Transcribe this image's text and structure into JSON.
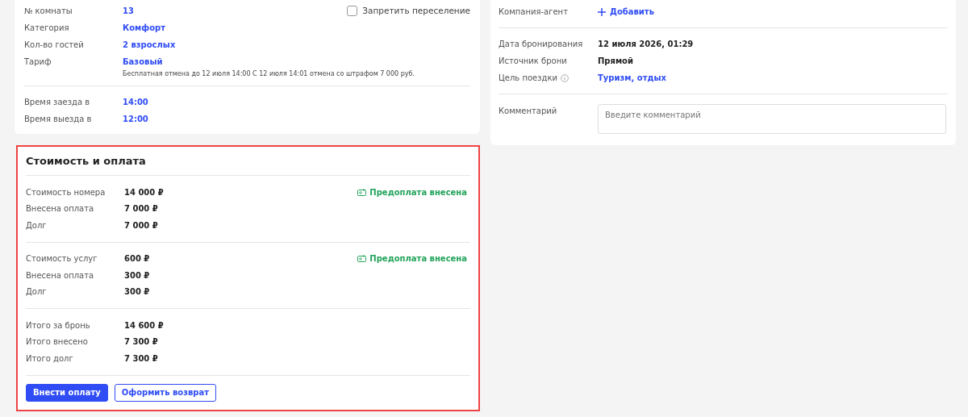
{
  "room_card": {
    "fields": [
      {
        "label": "№ комнаты",
        "value": "13",
        "kind": "link"
      },
      {
        "label": "Категория",
        "value": "Комфорт",
        "kind": "link"
      },
      {
        "label": "Кол-во гостей",
        "value": "2 взрослых",
        "kind": "link"
      },
      {
        "label": "Тариф",
        "value": "Базовый",
        "kind": "link",
        "note": "Бесплатная отмена до 12 июля 14:00 С 12 июля 14:01 отмена со штрафом 7 000 руб."
      }
    ],
    "relocation": {
      "label": "Запретить переселение",
      "checked": false
    },
    "times": [
      {
        "label": "Время заезда в",
        "value": "14:00",
        "kind": "link"
      },
      {
        "label": "Время выезда в",
        "value": "12:00",
        "kind": "link"
      }
    ]
  },
  "agent_card": {
    "agent": {
      "label": "Компания-агент",
      "action": "Добавить"
    },
    "booking": [
      {
        "label": "Дата бронирования",
        "value": "12 июля 2026, 01:29",
        "kind": "text",
        "info": false
      },
      {
        "label": "Источник брони",
        "value": "Прямой",
        "kind": "text",
        "info": false
      },
      {
        "label": "Цель поездки",
        "value": "Туризм, отдых",
        "kind": "link",
        "info": true
      }
    ],
    "comment": {
      "label": "Комментарий",
      "placeholder": "Введите комментарий"
    }
  },
  "payment": {
    "title": "Стоимость и оплата",
    "highlighted": true,
    "groups": [
      {
        "badge": "Предоплата внесена",
        "rows": [
          {
            "label": "Стоимость номера",
            "value": "14 000 ₽"
          },
          {
            "label": "Внесена оплата",
            "value": "7 000 ₽"
          },
          {
            "label": "Долг",
            "value": "7 000 ₽"
          }
        ]
      },
      {
        "badge": "Предоплата внесена",
        "rows": [
          {
            "label": "Стоимость услуг",
            "value": "600 ₽"
          },
          {
            "label": "Внесена оплата",
            "value": "300 ₽"
          },
          {
            "label": "Долг",
            "value": "300 ₽"
          }
        ]
      },
      {
        "rows": [
          {
            "label": "Итого за бронь",
            "value": "14 600 ₽"
          },
          {
            "label": "Итого внесено",
            "value": "7 300 ₽"
          },
          {
            "label": "Итого долг",
            "value": "7 300 ₽"
          }
        ]
      }
    ],
    "buttons": [
      {
        "label": "Внести оплату",
        "kind": "primary"
      },
      {
        "label": "Оформить возврат",
        "kind": "secondary"
      }
    ]
  }
}
